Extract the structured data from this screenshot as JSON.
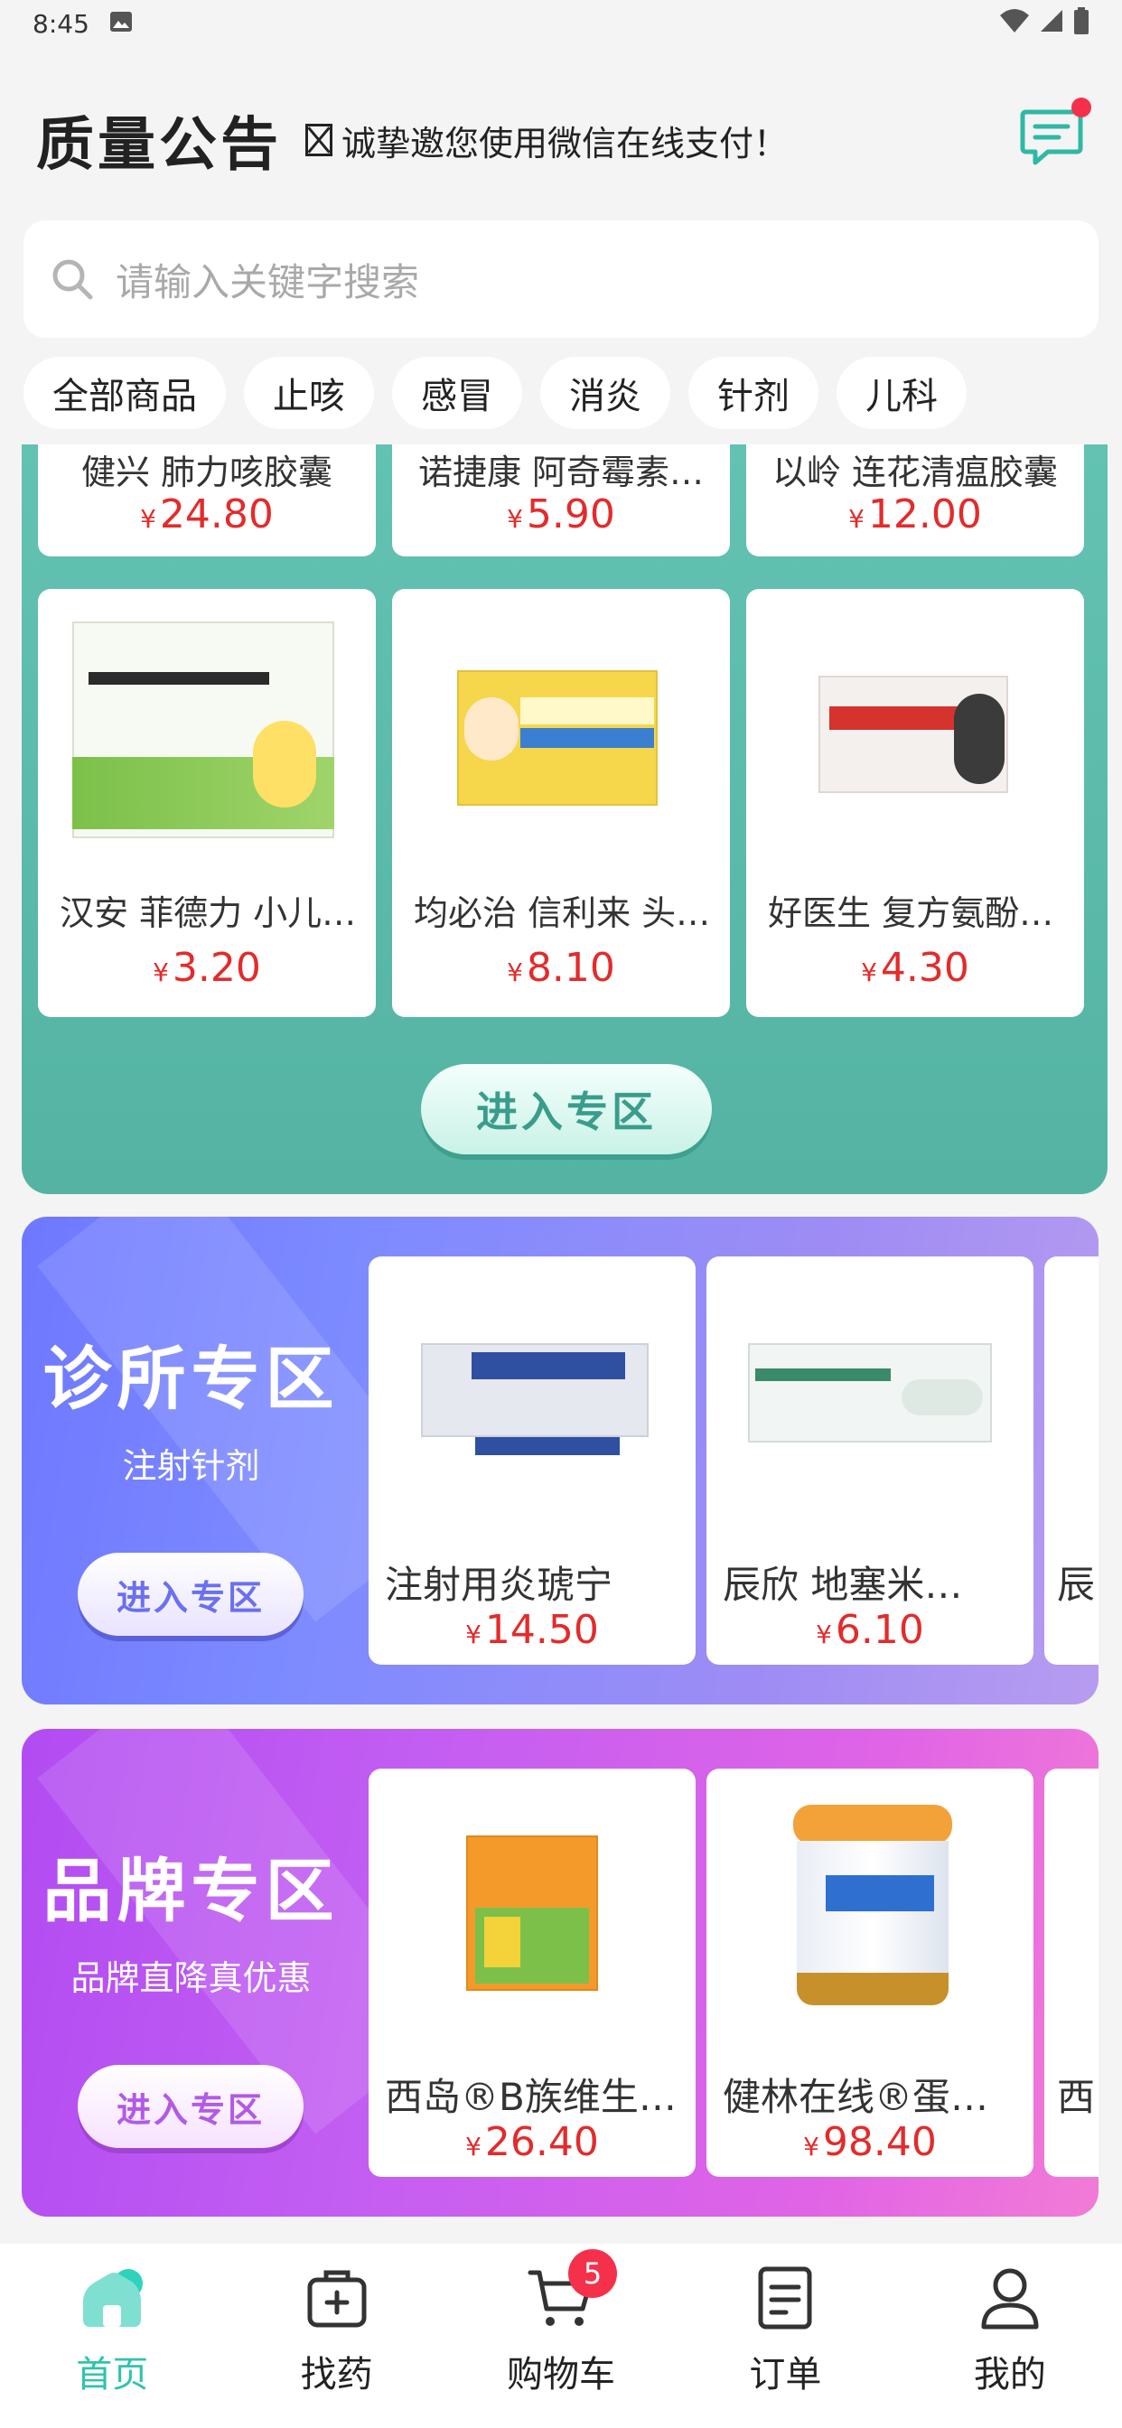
{
  "status_bar": {
    "time": "8:45"
  },
  "header": {
    "notice_title": "质量公告",
    "notice_text": "诚挚邀您使用微信在线支付！"
  },
  "search": {
    "placeholder": "请输入关键字搜索"
  },
  "categories": [
    "全部商品",
    "止咳",
    "感冒",
    "消炎",
    "针剂",
    "儿科"
  ],
  "teal_section": {
    "row1": [
      {
        "name": "健兴 肺力咳胶囊",
        "price": "24.80"
      },
      {
        "name": "诺捷康 阿奇霉素…",
        "price": "5.90"
      },
      {
        "name": "以岭 连花清瘟胶囊",
        "price": "12.00"
      }
    ],
    "row2": [
      {
        "name": "汉安 菲德力 小儿…",
        "price": "3.20"
      },
      {
        "name": "均必治 信利来 头…",
        "price": "8.10"
      },
      {
        "name": "好医生 复方氨酚…",
        "price": "4.30"
      }
    ],
    "enter_label": "进入专区"
  },
  "clinic_zone": {
    "title": "诊所专区",
    "subtitle": "注射针剂",
    "enter_label": "进入专区",
    "products": [
      {
        "name": "注射用炎琥宁",
        "price": "14.50"
      },
      {
        "name": "辰欣 地塞米…",
        "price": "6.10"
      },
      {
        "name": "辰",
        "price": ""
      }
    ]
  },
  "brand_zone": {
    "title": "品牌专区",
    "subtitle": "品牌直降真优惠",
    "enter_label": "进入专区",
    "products": [
      {
        "name": "西岛®B族维生…",
        "price": "26.40"
      },
      {
        "name": "健林在线®蛋…",
        "price": "98.40"
      },
      {
        "name": "西",
        "price": ""
      }
    ]
  },
  "currency_symbol": "¥",
  "bottom_nav": {
    "home": "首页",
    "find": "找药",
    "cart": "购物车",
    "cart_badge": "5",
    "orders": "订单",
    "mine": "我的"
  },
  "colors": {
    "accent": "#2fc3ad",
    "price": "#e32b2b",
    "teal_bg": "#5dbcad",
    "clinic_bg": "#7682ff",
    "brand_bg": "#c35ef2"
  }
}
